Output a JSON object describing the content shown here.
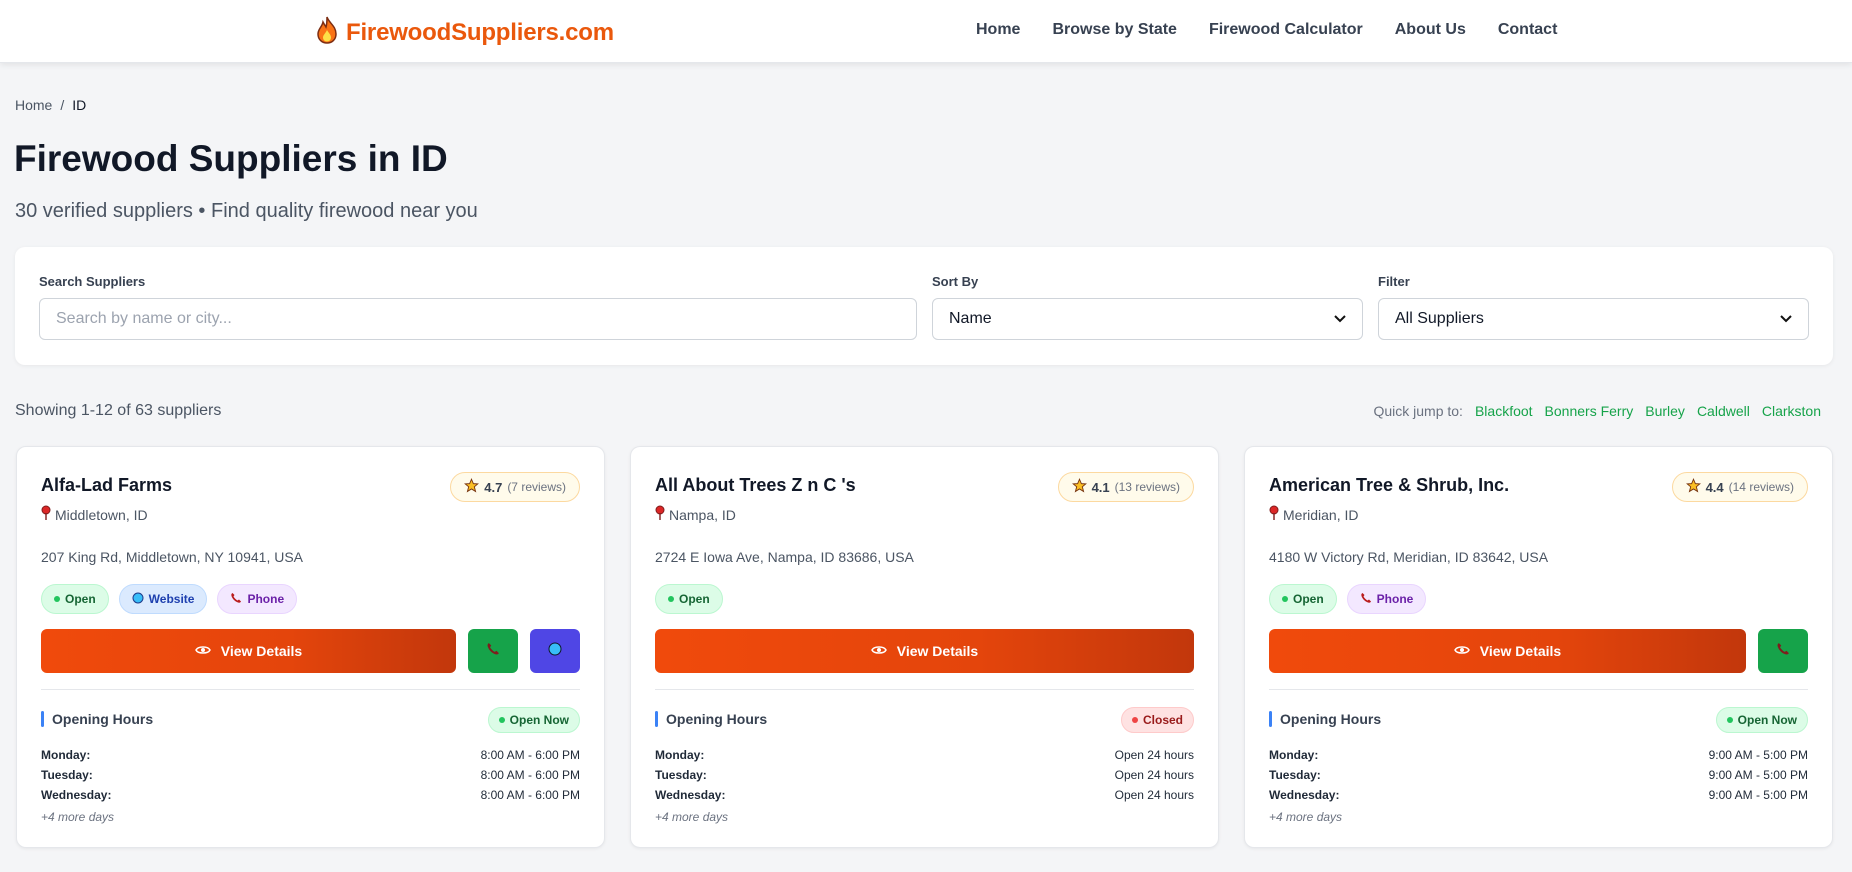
{
  "header": {
    "logo_text": "FirewoodSuppliers.com",
    "nav": [
      "Home",
      "Browse by State",
      "Firewood Calculator",
      "About Us",
      "Contact"
    ]
  },
  "breadcrumb": {
    "home": "Home",
    "sep": "/",
    "current": "ID"
  },
  "page": {
    "title": "Firewood Suppliers in ID",
    "subtitle": "30 verified suppliers • Find quality firewood near you"
  },
  "filters": {
    "search_label": "Search Suppliers",
    "search_placeholder": "Search by name or city...",
    "sort_label": "Sort By",
    "sort_value": "Name",
    "filter_label": "Filter",
    "filter_value": "All Suppliers"
  },
  "results": {
    "showing": "Showing 1-12 of 63 suppliers",
    "quick_jump_label": "Quick jump to:",
    "quick_jump": [
      "Blackfoot",
      "Bonners Ferry",
      "Burley",
      "Caldwell",
      "Clarkston"
    ]
  },
  "cards": [
    {
      "name": "Alfa-Lad Farms",
      "rating": "4.7",
      "reviews": "(7 reviews)",
      "location": "Middletown, ID",
      "address": "207 King Rd, Middletown, NY 10941, USA",
      "tags": {
        "open": "Open",
        "website": "Website",
        "phone": "Phone"
      },
      "view_label": "View Details",
      "hours_title": "Opening Hours",
      "status": "Open Now",
      "hours": [
        {
          "day": "Monday:",
          "time": "8:00 AM - 6:00 PM"
        },
        {
          "day": "Tuesday:",
          "time": "8:00 AM - 6:00 PM"
        },
        {
          "day": "Wednesday:",
          "time": "8:00 AM - 6:00 PM"
        }
      ],
      "more": "+4 more days"
    },
    {
      "name": "All About Trees Z n C 's",
      "rating": "4.1",
      "reviews": "(13 reviews)",
      "location": "Nampa, ID",
      "address": "2724 E Iowa Ave, Nampa, ID 83686, USA",
      "tags": {
        "open": "Open"
      },
      "view_label": "View Details",
      "hours_title": "Opening Hours",
      "status": "Closed",
      "hours": [
        {
          "day": "Monday:",
          "time": "Open 24 hours"
        },
        {
          "day": "Tuesday:",
          "time": "Open 24 hours"
        },
        {
          "day": "Wednesday:",
          "time": "Open 24 hours"
        }
      ],
      "more": "+4 more days"
    },
    {
      "name": "American Tree & Shrub, Inc.",
      "rating": "4.4",
      "reviews": "(14 reviews)",
      "location": "Meridian, ID",
      "address": "4180 W Victory Rd, Meridian, ID 83642, USA",
      "tags": {
        "open": "Open",
        "phone": "Phone"
      },
      "view_label": "View Details",
      "hours_title": "Opening Hours",
      "status": "Open Now",
      "hours": [
        {
          "day": "Monday:",
          "time": "9:00 AM - 5:00 PM"
        },
        {
          "day": "Tuesday:",
          "time": "9:00 AM - 5:00 PM"
        },
        {
          "day": "Wednesday:",
          "time": "9:00 AM - 5:00 PM"
        }
      ],
      "more": "+4 more days"
    }
  ],
  "colors": {
    "brand": "#ea580c",
    "link_green": "#16a34a",
    "call_green": "#16a34a",
    "web_indigo": "#4f46e5"
  },
  "icons": [
    "flame-icon",
    "pin-icon",
    "star-icon",
    "globe-icon",
    "phone-icon",
    "eye-icon",
    "chevron-down-icon"
  ]
}
